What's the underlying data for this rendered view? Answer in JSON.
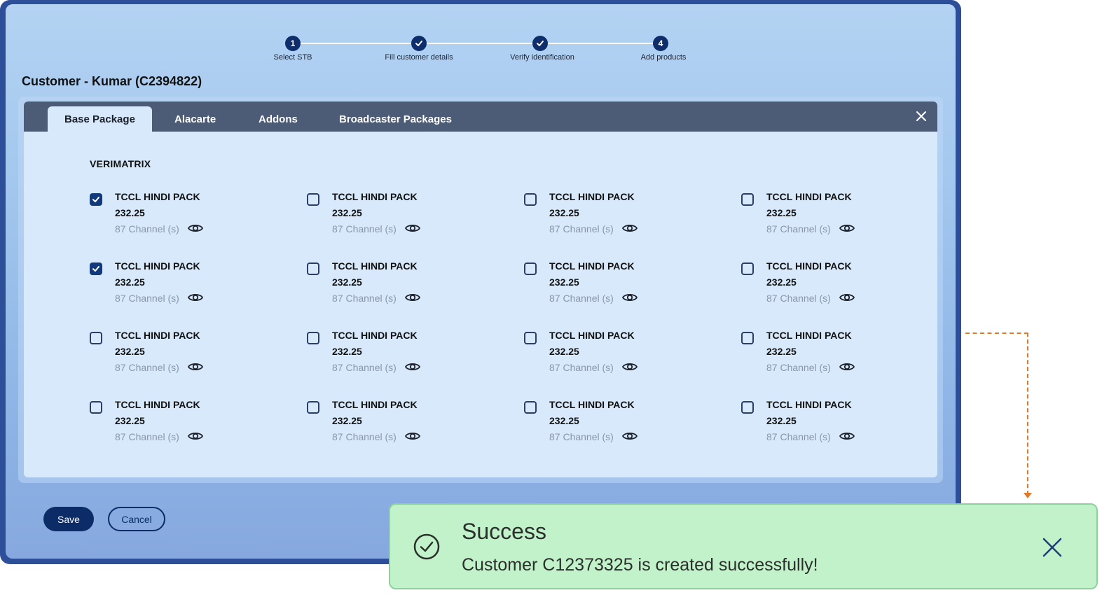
{
  "stepper": {
    "steps": [
      {
        "label": "Select STB",
        "number": "1",
        "state": "current"
      },
      {
        "label": "Fill customer details",
        "number": "",
        "state": "done"
      },
      {
        "label": "Verify identification",
        "number": "",
        "state": "done"
      },
      {
        "label": "Add products",
        "number": "4",
        "state": "pending"
      }
    ]
  },
  "customer_title": "Customer - Kumar (C2394822)",
  "tabs": [
    {
      "label": "Base Package",
      "active": true
    },
    {
      "label": "Alacarte",
      "active": false
    },
    {
      "label": "Addons",
      "active": false
    },
    {
      "label": "Broadcaster Packages",
      "active": false
    }
  ],
  "vendor": "VERIMATRIX",
  "packages": [
    {
      "name": "TCCL HINDI PACK",
      "price": "232.25",
      "channels": "87 Channel (s)",
      "checked": true
    },
    {
      "name": "TCCL HINDI PACK",
      "price": "232.25",
      "channels": "87 Channel (s)",
      "checked": false
    },
    {
      "name": "TCCL HINDI PACK",
      "price": "232.25",
      "channels": "87 Channel (s)",
      "checked": false
    },
    {
      "name": "TCCL HINDI PACK",
      "price": "232.25",
      "channels": "87 Channel (s)",
      "checked": false
    },
    {
      "name": "TCCL HINDI PACK",
      "price": "232.25",
      "channels": "87 Channel (s)",
      "checked": true
    },
    {
      "name": "TCCL HINDI PACK",
      "price": "232.25",
      "channels": "87 Channel (s)",
      "checked": false
    },
    {
      "name": "TCCL HINDI PACK",
      "price": "232.25",
      "channels": "87 Channel (s)",
      "checked": false
    },
    {
      "name": "TCCL HINDI PACK",
      "price": "232.25",
      "channels": "87 Channel (s)",
      "checked": false
    },
    {
      "name": "TCCL HINDI PACK",
      "price": "232.25",
      "channels": "87 Channel (s)",
      "checked": false
    },
    {
      "name": "TCCL HINDI PACK",
      "price": "232.25",
      "channels": "87 Channel (s)",
      "checked": false
    },
    {
      "name": "TCCL HINDI PACK",
      "price": "232.25",
      "channels": "87 Channel (s)",
      "checked": false
    },
    {
      "name": "TCCL HINDI PACK",
      "price": "232.25",
      "channels": "87 Channel (s)",
      "checked": false
    },
    {
      "name": "TCCL HINDI PACK",
      "price": "232.25",
      "channels": "87 Channel (s)",
      "checked": false
    },
    {
      "name": "TCCL HINDI PACK",
      "price": "232.25",
      "channels": "87 Channel (s)",
      "checked": false
    },
    {
      "name": "TCCL HINDI PACK",
      "price": "232.25",
      "channels": "87 Channel (s)",
      "checked": false
    },
    {
      "name": "TCCL HINDI PACK",
      "price": "232.25",
      "channels": "87 Channel (s)",
      "checked": false
    }
  ],
  "buttons": {
    "save": "Save",
    "cancel": "Cancel"
  },
  "toast": {
    "title": "Success",
    "message": "Customer C12373325 is created successfully!"
  },
  "icons": {
    "close": "close-icon",
    "view": "eye-icon",
    "success": "check-circle-icon",
    "step_done": "check-icon"
  },
  "colors": {
    "primary": "#0c2c68",
    "tabbar": "#4c5c77",
    "modal_bg": "#d7e9fb",
    "toast_bg": "#c2f2c9",
    "connector": "#e07a2a"
  }
}
